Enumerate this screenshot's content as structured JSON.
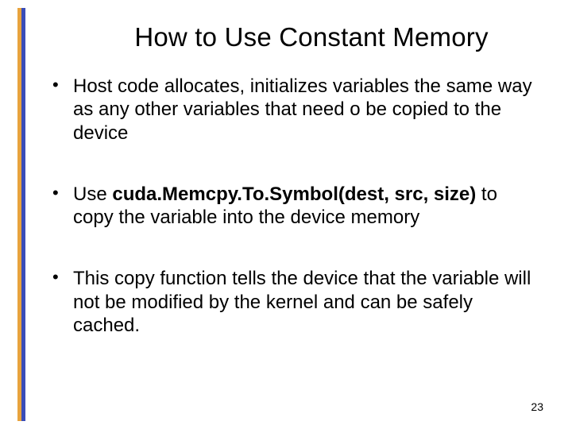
{
  "slide": {
    "title": "How to Use Constant Memory",
    "bullets": [
      {
        "pre": "Host code allocates, initializes variables the same way as any other variables that need o be copied to the device",
        "bold": "",
        "post": ""
      },
      {
        "pre": "Use  ",
        "bold": "cuda.Memcpy.To.Symbol(dest, src, size)",
        "post": " to copy the variable into the device memory"
      },
      {
        "pre": "This copy function tells the device that the variable will not be modified by the kernel and can be safely cached.",
        "bold": "",
        "post": ""
      }
    ],
    "page": "23"
  }
}
